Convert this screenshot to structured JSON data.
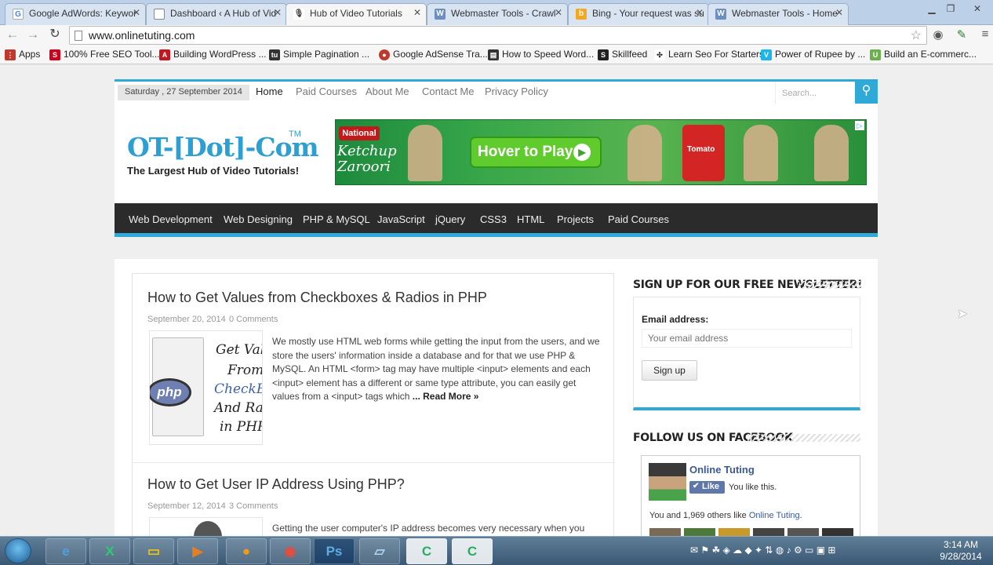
{
  "browser": {
    "tabs": [
      {
        "title": "Google AdWords: Keywor",
        "favicon": "google-icon",
        "active": false
      },
      {
        "title": "Dashboard ‹ A Hub of Vid",
        "favicon": "page-icon",
        "active": false
      },
      {
        "title": "Hub of Video Tutorials",
        "favicon": "site-icon",
        "active": true
      },
      {
        "title": "Webmaster Tools - Crawl",
        "favicon": "webmaster-icon",
        "active": false
      },
      {
        "title": "Bing - Your request was su",
        "favicon": "bing-icon",
        "active": false
      },
      {
        "title": "Webmaster Tools - Home",
        "favicon": "webmaster-icon",
        "active": false
      }
    ],
    "url": "www.onlinetuting.com",
    "bookmarks": [
      {
        "label": "Apps",
        "icon": "apps-grid-icon",
        "color": "#c0392b"
      },
      {
        "label": "100% Free SEO Tool...",
        "icon": "seo-icon",
        "color": "#d0021b"
      },
      {
        "label": "Building WordPress ...",
        "icon": "adobe-icon",
        "color": "#c4161c"
      },
      {
        "label": "Simple Pagination ...",
        "icon": "tutorial-icon",
        "color": "#333333"
      },
      {
        "label": "Google AdSense Tra...",
        "icon": "adsense-icon",
        "color": "#c0392b"
      },
      {
        "label": "How to Speed Word...",
        "icon": "film-icon",
        "color": "#333333"
      },
      {
        "label": "Skillfeed",
        "icon": "skillfeed-icon",
        "color": "#222222"
      },
      {
        "label": "Learn Seo For Starters",
        "icon": "arrows-icon",
        "color": "#222222"
      },
      {
        "label": "Power of Rupee by ...",
        "icon": "vimeo-icon",
        "color": "#1ab7ea"
      },
      {
        "label": "Build an E-commerc...",
        "icon": "udemy-icon",
        "color": "#6ab04c"
      }
    ]
  },
  "site": {
    "date": "Saturday , 27 September 2014",
    "topnav": [
      "Home",
      "Paid Courses",
      "About Me",
      "Contact Me",
      "Privacy Policy"
    ],
    "search_placeholder": "Search...",
    "logo": {
      "title": "OT-[Dot]-Com",
      "tm": "TM",
      "tagline": "The Largest Hub of Video Tutorials!"
    },
    "ad": {
      "brand": "National",
      "product": "Ketchup Zaroori",
      "cta": "Hover to Play",
      "pack_label": "Tomato"
    },
    "mainnav": [
      "Web Development",
      "Web Designing",
      "PHP & MySQL",
      "JavaScript",
      "jQuery",
      "CSS3",
      "HTML",
      "Projects",
      "Paid Courses"
    ],
    "accent": "#2fa9d8"
  },
  "posts": [
    {
      "title": "How to Get Values from Checkboxes & Radios in PHP",
      "date": "September 20, 2014",
      "comments": "0 Comments",
      "thumb_lines": [
        "Get Val",
        "From",
        "CheckB",
        "And Ra",
        "in PHP"
      ],
      "thumb_badge": "php",
      "excerpt": "We mostly use HTML web forms while getting the input from the users, and we store the users' information inside a database and for that we use PHP & MySQL. An HTML <form> tag may have multiple <input> elements and each <input> element has a different or same type attribute, you can easily get values from a <input> tags which",
      "read_more": "... Read More »"
    },
    {
      "title": "How to Get User IP Address Using PHP?",
      "date": "September 12, 2014",
      "comments": "3 Comments",
      "excerpt": "Getting the user computer's IP address becomes very necessary when you"
    }
  ],
  "sidebar": {
    "newsletter_title": "SIGN UP FOR OUR FREE NEWSLETTER!",
    "email_label": "Email address:",
    "email_placeholder": "Your email address",
    "signup_label": "Sign up",
    "facebook_title": "FOLLOW US ON FACEBOOK",
    "fb_page": "Online Tuting",
    "fb_like": "Like",
    "fb_you": "You like this.",
    "fb_count_prefix": "You and 1,969 others like ",
    "fb_count_link": "Online Tuting",
    "fb_count_suffix": "."
  },
  "taskbar": {
    "apps": [
      "internet-explorer-icon",
      "excel-icon",
      "file-explorer-icon",
      "media-player-icon",
      "vlc-icon",
      "chrome-icon",
      "photoshop-icon",
      "notepad-icon",
      "camtasia-icon",
      "camtasia-recorder-icon"
    ],
    "time": "3:14 AM",
    "date": "9/28/2014"
  }
}
